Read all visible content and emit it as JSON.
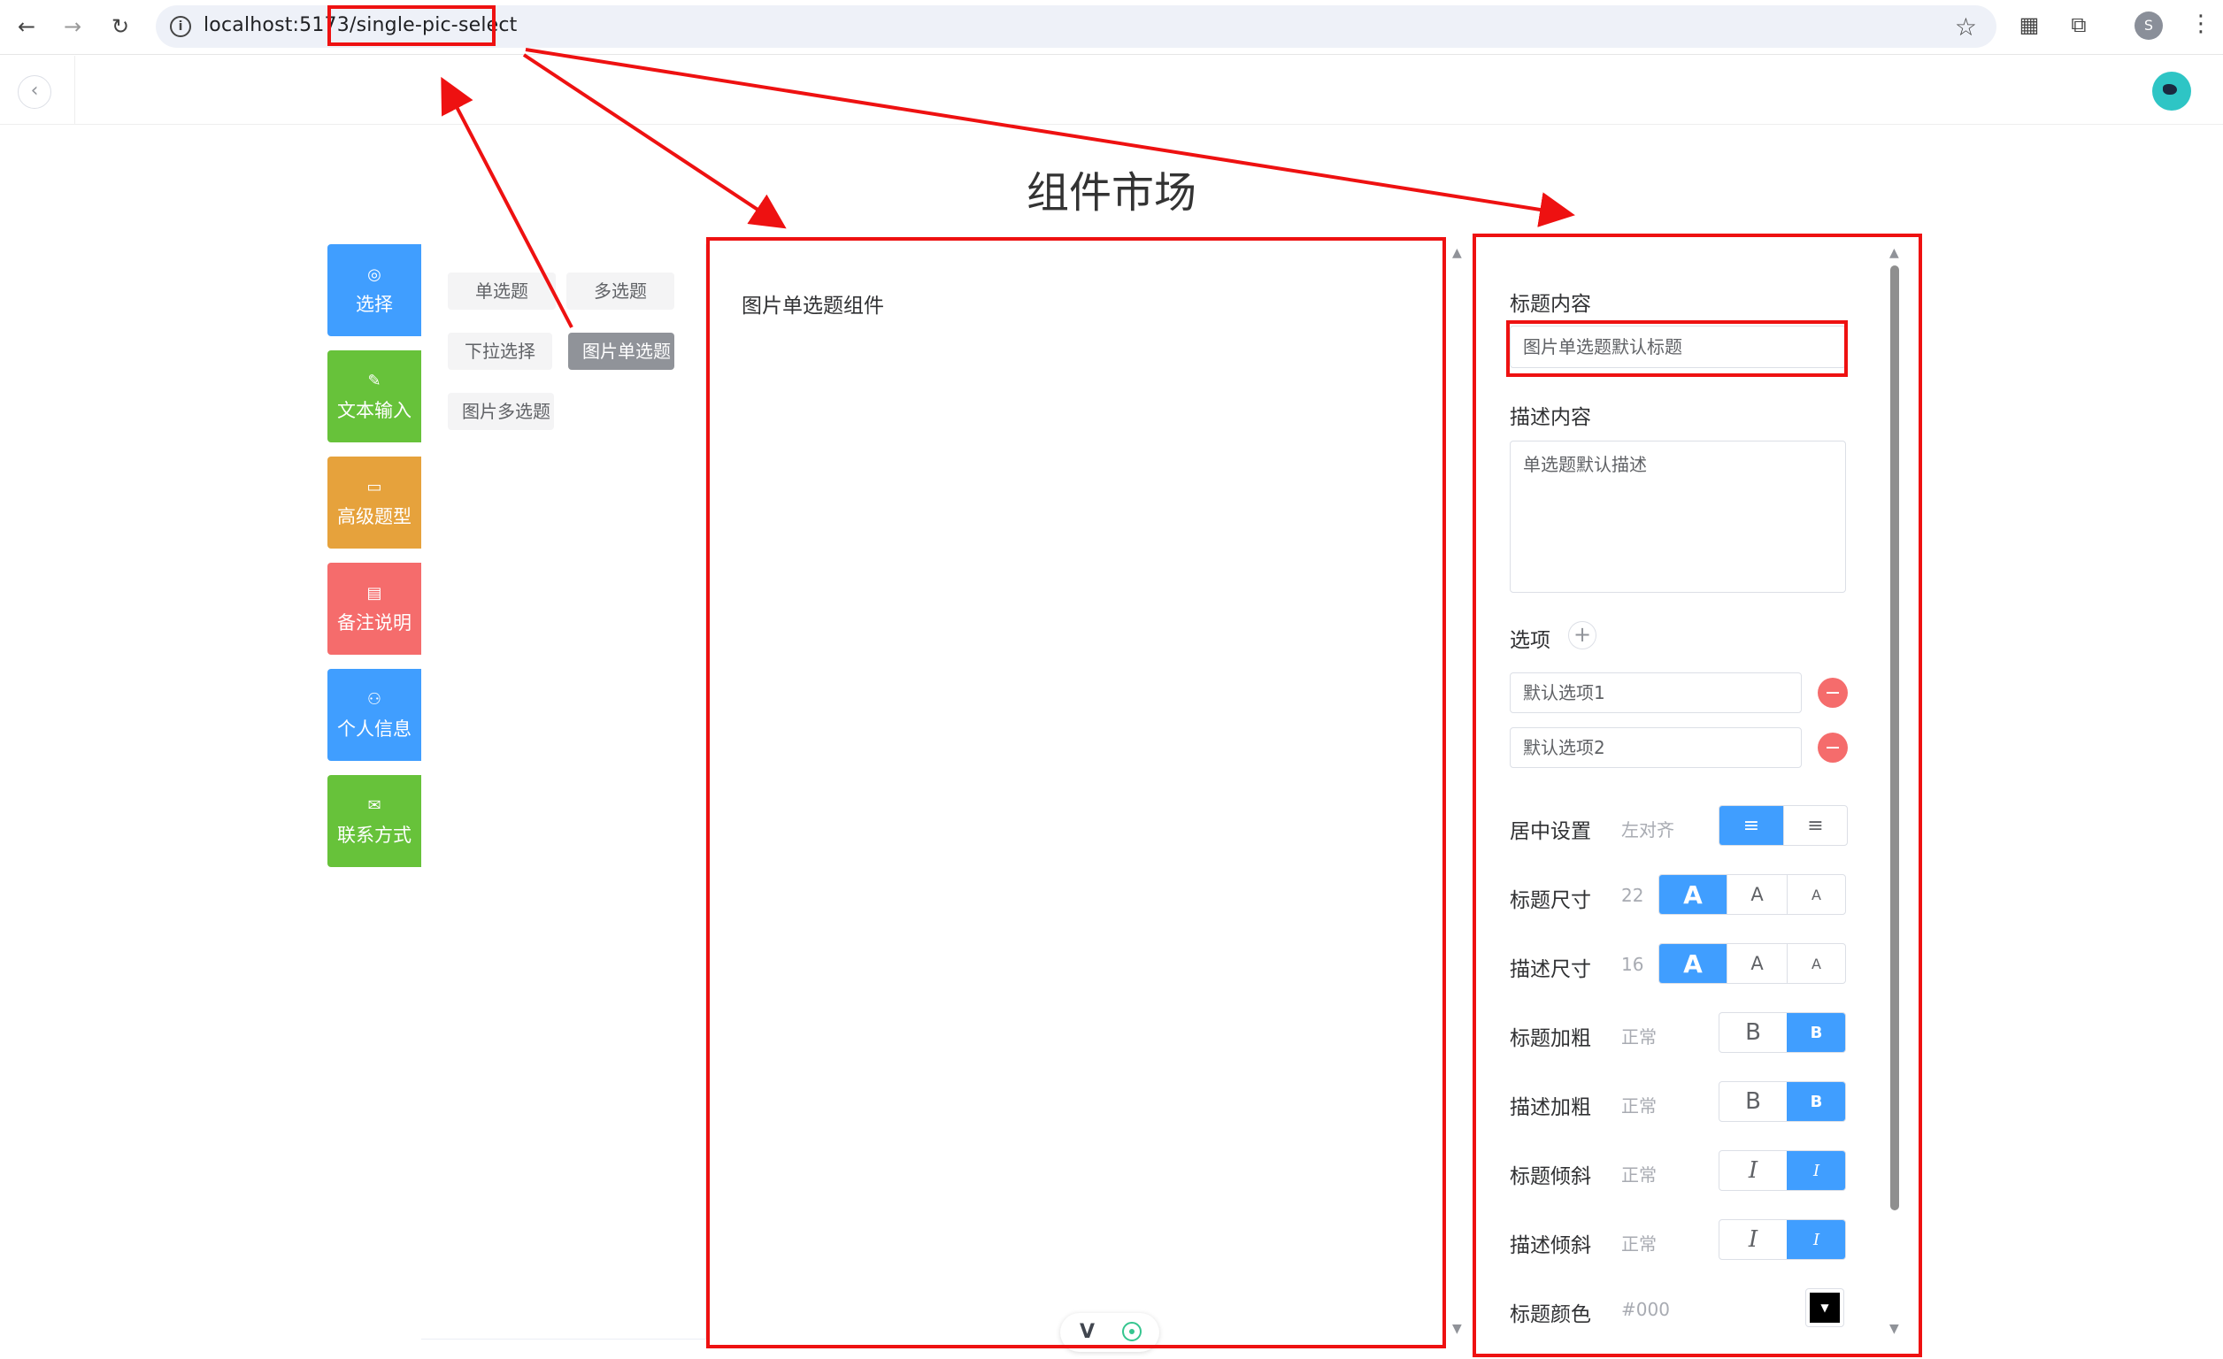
{
  "browser": {
    "url": "localhost:5173/single-pic-select",
    "profile_initial": "S"
  },
  "app": {
    "page_title": "组件市场"
  },
  "categories": [
    {
      "label": "选择",
      "icon": "check-circle-icon",
      "color": "#409eff"
    },
    {
      "label": "文本输入",
      "icon": "edit-icon",
      "color": "#67c23a"
    },
    {
      "label": "高级题型",
      "icon": "box-icon",
      "color": "#e6a23c"
    },
    {
      "label": "备注说明",
      "icon": "message-icon",
      "color": "#f56c6c"
    },
    {
      "label": "个人信息",
      "icon": "user-icon",
      "color": "#409eff"
    },
    {
      "label": "联系方式",
      "icon": "mail-icon",
      "color": "#67c23a"
    }
  ],
  "components": [
    {
      "label": "单选题",
      "active": false
    },
    {
      "label": "多选题",
      "active": false
    },
    {
      "label": "下拉选择",
      "active": false
    },
    {
      "label": "图片单选题",
      "active": true
    },
    {
      "label": "图片多选题",
      "active": false
    }
  ],
  "preview": {
    "title": "图片单选题组件"
  },
  "settings": {
    "title_label": "标题内容",
    "title_placeholder": "图片单选题默认标题",
    "desc_label": "描述内容",
    "desc_placeholder": "单选题默认描述",
    "options_label": "选项",
    "options": [
      "默认选项1",
      "默认选项2"
    ],
    "align": {
      "label": "居中设置",
      "value": "左对齐"
    },
    "title_size": {
      "label": "标题尺寸",
      "value": "22"
    },
    "desc_size": {
      "label": "描述尺寸",
      "value": "16"
    },
    "title_bold": {
      "label": "标题加粗",
      "value": "正常"
    },
    "desc_bold": {
      "label": "描述加粗",
      "value": "正常"
    },
    "title_italic": {
      "label": "标题倾斜",
      "value": "正常"
    },
    "desc_italic": {
      "label": "描述倾斜",
      "value": "正常"
    },
    "title_color": {
      "label": "标题颜色",
      "value": "#000"
    },
    "size_glyph": "A",
    "bold_glyph": "B",
    "italic_glyph": "I"
  },
  "colors": {
    "accent": "#409eff",
    "annotation_red": "#ee1111"
  }
}
